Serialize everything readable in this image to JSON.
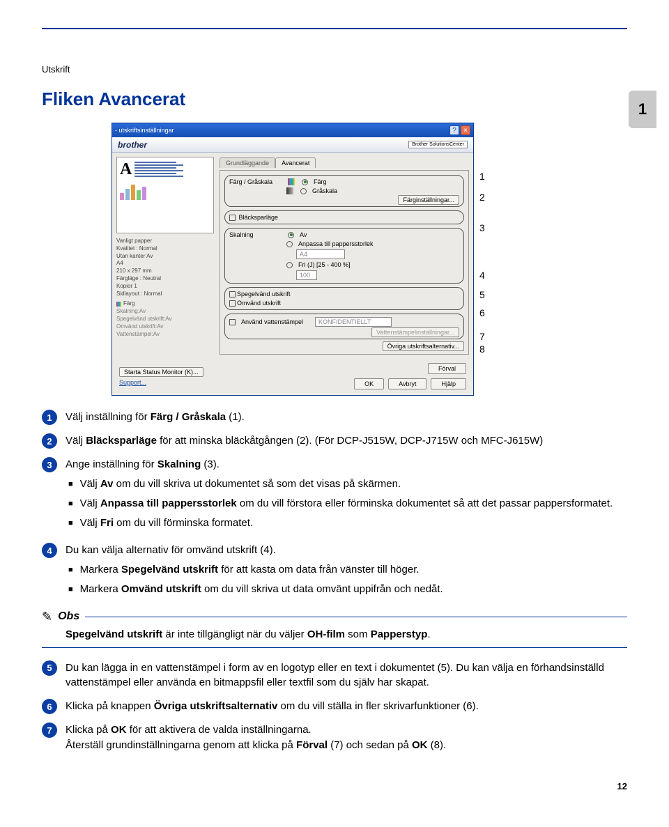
{
  "page": {
    "section": "Utskrift",
    "title": "Fliken Avancerat",
    "side_tab": "1",
    "page_number": "12"
  },
  "callouts": {
    "c1": "1",
    "c2": "2",
    "c3": "3",
    "c4": "4",
    "c5": "5",
    "c6": "6",
    "c7": "7",
    "c8": "8"
  },
  "dialog": {
    "title": "- utskriftsinställningar",
    "brand": "brother",
    "solutions": "Brother SolutionsCenter",
    "tabs": {
      "basic": "Grundläggande",
      "advanced": "Avancerat"
    },
    "summary": {
      "l1": "Vanligt papper",
      "l2": "Kvalitet : Normal",
      "l3": "Utan kanter Av",
      "l4": "A4",
      "l5": "210 x 297 mm",
      "l6": "Färgläge : Neutral",
      "l7": "Kopior 1",
      "l8": "Sidlayout : Normal",
      "c_label": "Färg",
      "sk": "Skalning:Av",
      "sp": "Spegelvänd utskrift:Av",
      "om": "Omvänd utskrift:Av",
      "vt": "Vattenstämpel:Av"
    },
    "grp_color": {
      "label": "Färg / Gråskala",
      "opt1": "Färg",
      "opt2": "Gråskala",
      "btn": "Färginställningar..."
    },
    "grp_ink": {
      "label": "Bläcksparläge"
    },
    "grp_scale": {
      "label": "Skalning",
      "opt1": "Av",
      "opt2": "Anpassa till pappersstorlek",
      "combo": "A4",
      "opt3": "Fri (J) [25 - 400 %]",
      "val": "100"
    },
    "grp_mirror": {
      "opt1": "Spegelvänd utskrift",
      "opt2": "Omvänd utskrift"
    },
    "grp_water": {
      "label": "Använd vattenstämpel",
      "combo": "KONFIDENTIELLT",
      "btn": "Vattenstämpelinställningar..."
    },
    "other_btn": "Övriga utskriftsalternativ...",
    "bottom": {
      "status": "Starta Status Monitor (K)...",
      "support": "Support...",
      "default": "Förval",
      "ok": "OK",
      "cancel": "Avbryt",
      "help": "Hjälp"
    }
  },
  "steps": {
    "s1": {
      "num": "1",
      "text_a": "Välj inställning för ",
      "b1": "Färg / Gråskala",
      "text_b": " (1)."
    },
    "s2": {
      "num": "2",
      "text_a": "Välj ",
      "b1": "Bläcksparläge",
      "text_b": " för att minska bläckåtgången (2). (För DCP-J515W, DCP-J715W och MFC-J615W)"
    },
    "s3": {
      "num": "3",
      "text_a": "Ange inställning för ",
      "b1": "Skalning",
      "text_b": " (3).",
      "sub1a": "Välj ",
      "sub1b": "Av",
      "sub1c": " om du vill skriva ut dokumentet så som det visas på skärmen.",
      "sub2a": "Välj ",
      "sub2b": "Anpassa till pappersstorlek",
      "sub2c": " om du vill förstora eller förminska dokumentet så att det passar pappersformatet.",
      "sub3a": "Välj ",
      "sub3b": "Fri",
      "sub3c": " om du vill förminska formatet."
    },
    "s4": {
      "num": "4",
      "text": "Du kan välja alternativ för omvänd utskrift (4).",
      "sub1a": "Markera ",
      "sub1b": "Spegelvänd utskrift",
      "sub1c": " för att kasta om data från vänster till höger.",
      "sub2a": "Markera ",
      "sub2b": "Omvänd utskrift",
      "sub2c": " om du vill skriva ut data omvänt uppifrån och nedåt."
    },
    "obs": {
      "label": "Obs",
      "a": "Spegelvänd utskrift",
      "b": " är inte tillgängligt när du väljer ",
      "c": "OH-film",
      "d": " som ",
      "e": "Papperstyp",
      "f": "."
    },
    "s5": {
      "num": "5",
      "text": "Du kan lägga in en vattenstämpel i form av en logotyp eller en text i dokumentet (5). Du kan välja en förhandsinställd vattenstämpel eller använda en bitmappsfil eller textfil som du själv har skapat."
    },
    "s6": {
      "num": "6",
      "a": "Klicka på knappen ",
      "b": "Övriga utskriftsalternativ",
      "c": " om du vill ställa in fler skrivarfunktioner (6)."
    },
    "s7": {
      "num": "7",
      "a": "Klicka på ",
      "b": "OK",
      "c": " för att aktivera de valda inställningarna.",
      "d": "Återställ grundinställningarna genom att klicka på ",
      "e": "Förval",
      "f": " (7) och sedan på ",
      "g": "OK",
      "h": " (8)."
    }
  }
}
